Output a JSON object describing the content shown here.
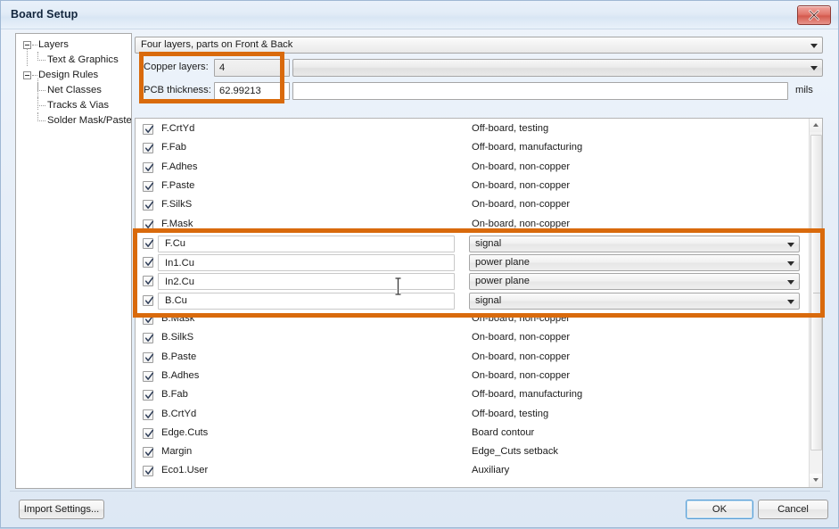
{
  "window": {
    "title": "Board Setup",
    "close_icon": "close-icon"
  },
  "sidebar": {
    "items": [
      {
        "label": "Layers",
        "level": 0,
        "expanded": true
      },
      {
        "label": "Text & Graphics",
        "level": 1
      },
      {
        "label": "Design Rules",
        "level": 0,
        "expanded": true
      },
      {
        "label": "Net Classes",
        "level": 1
      },
      {
        "label": "Tracks & Vias",
        "level": 1
      },
      {
        "label": "Solder Mask/Paste",
        "level": 1
      }
    ]
  },
  "main": {
    "preset": {
      "value": "Four layers, parts on Front & Back",
      "arrow_icon": "chevron-down-icon"
    },
    "copper_layers": {
      "label": "Copper layers:",
      "value": "4",
      "arrow_icon": "chevron-down-icon"
    },
    "pcb_thickness": {
      "label": "PCB thickness:",
      "value": "62.99213",
      "unit": "mils"
    }
  },
  "layers": [
    {
      "name": "F.CrtYd",
      "desc": "Off-board, testing",
      "checked": true,
      "copper": false
    },
    {
      "name": "F.Fab",
      "desc": "Off-board, manufacturing",
      "checked": true,
      "copper": false
    },
    {
      "name": "F.Adhes",
      "desc": "On-board, non-copper",
      "checked": true,
      "copper": false
    },
    {
      "name": "F.Paste",
      "desc": "On-board, non-copper",
      "checked": true,
      "copper": false
    },
    {
      "name": "F.SilkS",
      "desc": "On-board, non-copper",
      "checked": true,
      "copper": false
    },
    {
      "name": "F.Mask",
      "desc": "On-board, non-copper",
      "checked": true,
      "copper": false
    },
    {
      "name": "F.Cu",
      "type": "signal",
      "checked": true,
      "copper": true
    },
    {
      "name": "In1.Cu",
      "type": "power plane",
      "checked": true,
      "copper": true
    },
    {
      "name": "In2.Cu",
      "type": "power plane",
      "checked": true,
      "copper": true
    },
    {
      "name": "B.Cu",
      "type": "signal",
      "checked": true,
      "copper": true
    },
    {
      "name": "B.Mask",
      "desc": "On-board, non-copper",
      "checked": true,
      "copper": false
    },
    {
      "name": "B.SilkS",
      "desc": "On-board, non-copper",
      "checked": true,
      "copper": false
    },
    {
      "name": "B.Paste",
      "desc": "On-board, non-copper",
      "checked": true,
      "copper": false
    },
    {
      "name": "B.Adhes",
      "desc": "On-board, non-copper",
      "checked": true,
      "copper": false
    },
    {
      "name": "B.Fab",
      "desc": "Off-board, manufacturing",
      "checked": true,
      "copper": false
    },
    {
      "name": "B.CrtYd",
      "desc": "Off-board, testing",
      "checked": true,
      "copper": false
    },
    {
      "name": "Edge.Cuts",
      "desc": "Board contour",
      "checked": true,
      "copper": false
    },
    {
      "name": "Margin",
      "desc": "Edge_Cuts setback",
      "checked": true,
      "copper": false
    },
    {
      "name": "Eco1.User",
      "desc": "Auxiliary",
      "checked": true,
      "copper": false
    }
  ],
  "footer": {
    "import_settings": "Import Settings...",
    "ok": "OK",
    "cancel": "Cancel"
  },
  "highlight_color": "#d96a0c",
  "scrollbar": {
    "up_icon": "scroll-up-arrow-icon",
    "down_icon": "scroll-down-arrow-icon"
  }
}
